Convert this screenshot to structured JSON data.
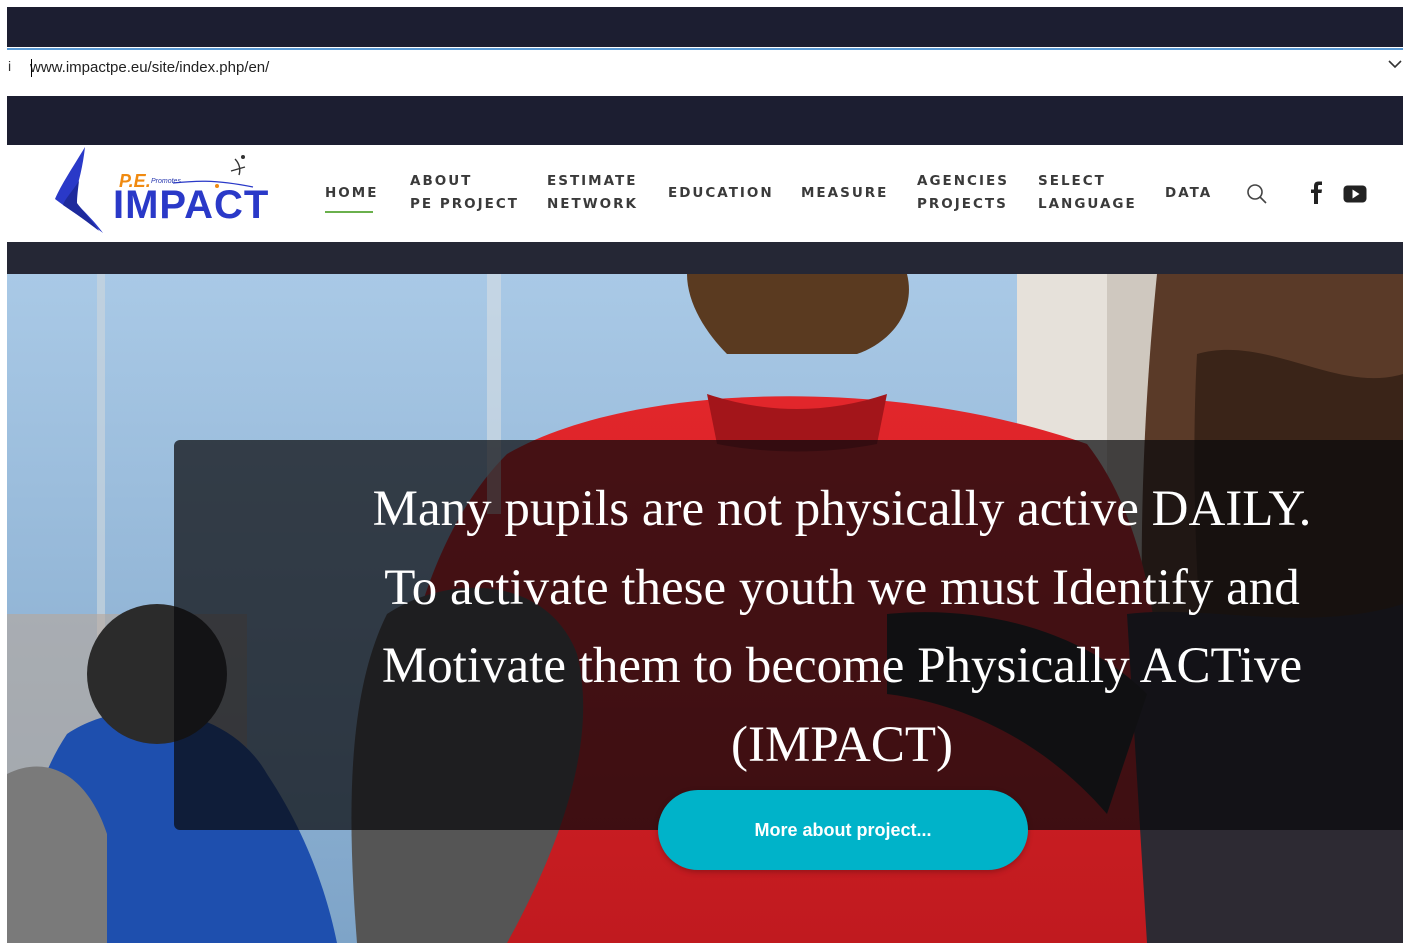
{
  "browser": {
    "info_icon": "i",
    "url": "www.impactpe.eu/site/index.php/en/"
  },
  "logo": {
    "pe_text": "P.E.",
    "promotes_text": "Promotes",
    "impact_text": "IMPACT"
  },
  "nav": {
    "home": "HOME",
    "about": [
      "ABOUT",
      "PE PROJECT"
    ],
    "estimate": [
      "ESTIMATE",
      "NETWORK"
    ],
    "education": "EDUCATION",
    "measure": "MEASURE",
    "agencies": [
      "AGENCIES",
      "PROJECTS"
    ],
    "language": [
      "SELECT",
      "LANGUAGE"
    ],
    "data": "DATA"
  },
  "icons": {
    "search": "search-icon",
    "facebook": "facebook-icon",
    "youtube": "youtube-icon"
  },
  "hero": {
    "headline_lines": [
      "Many pupils are not physically active DAILY.",
      "To activate these youth we must Identify and",
      "Motivate them to become Physically ACTive",
      "(IMPACT)"
    ],
    "cta_label": "More about project..."
  },
  "colors": {
    "accent_cta": "#00b3c9",
    "nav_active_underline": "#6ab04c",
    "logo_blue": "#2a39c8",
    "logo_orange": "#f08a10",
    "dark_band": "#1c1e31"
  }
}
